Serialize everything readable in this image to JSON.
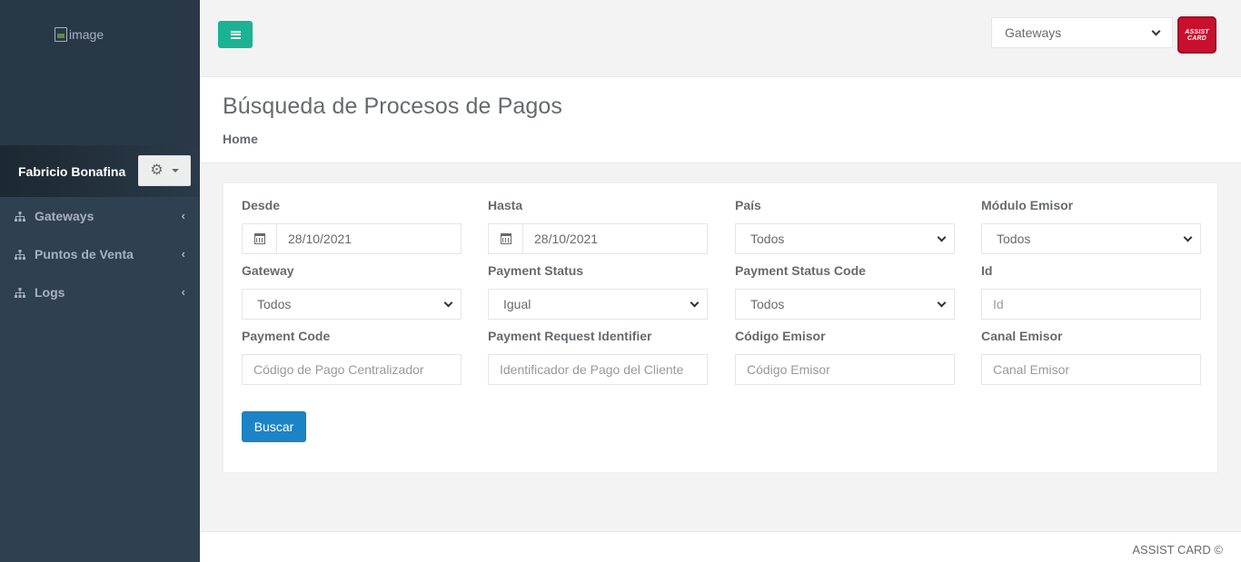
{
  "sidebar": {
    "logo_alt": "image",
    "user_name": "Fabricio Bonafina",
    "items": [
      {
        "label": "Gateways"
      },
      {
        "label": "Puntos de Venta"
      },
      {
        "label": "Logs"
      }
    ]
  },
  "topbar": {
    "selector_value": "Gateways",
    "brand_logo_text": "ASSIST CARD"
  },
  "heading": {
    "title": "Búsqueda de Procesos de Pagos",
    "breadcrumb": "Home"
  },
  "form": {
    "desde": {
      "label": "Desde",
      "value": "28/10/2021"
    },
    "hasta": {
      "label": "Hasta",
      "value": "28/10/2021"
    },
    "pais": {
      "label": "País",
      "value": "Todos"
    },
    "modulo_emisor": {
      "label": "Módulo Emisor",
      "value": "Todos"
    },
    "gateway": {
      "label": "Gateway",
      "value": "Todos"
    },
    "payment_status": {
      "label": "Payment Status",
      "value": "Igual"
    },
    "payment_status_code": {
      "label": "Payment Status Code",
      "value": "Todos"
    },
    "id": {
      "label": "Id",
      "placeholder": "Id"
    },
    "payment_code": {
      "label": "Payment Code",
      "placeholder": "Código de Pago Centralizador"
    },
    "payment_request_identifier": {
      "label": "Payment Request Identifier",
      "placeholder": "Identificador de Pago del Cliente"
    },
    "codigo_emisor": {
      "label": "Código Emisor",
      "placeholder": "Código Emisor"
    },
    "canal_emisor": {
      "label": "Canal Emisor",
      "placeholder": "Canal Emisor"
    },
    "submit_label": "Buscar"
  },
  "footer": {
    "text": "ASSIST CARD ©"
  },
  "colors": {
    "sidebar_bg": "#2f4050",
    "primary_green": "#1ab394",
    "button_blue": "#1c84c6",
    "brand_red": "#c8102e"
  }
}
